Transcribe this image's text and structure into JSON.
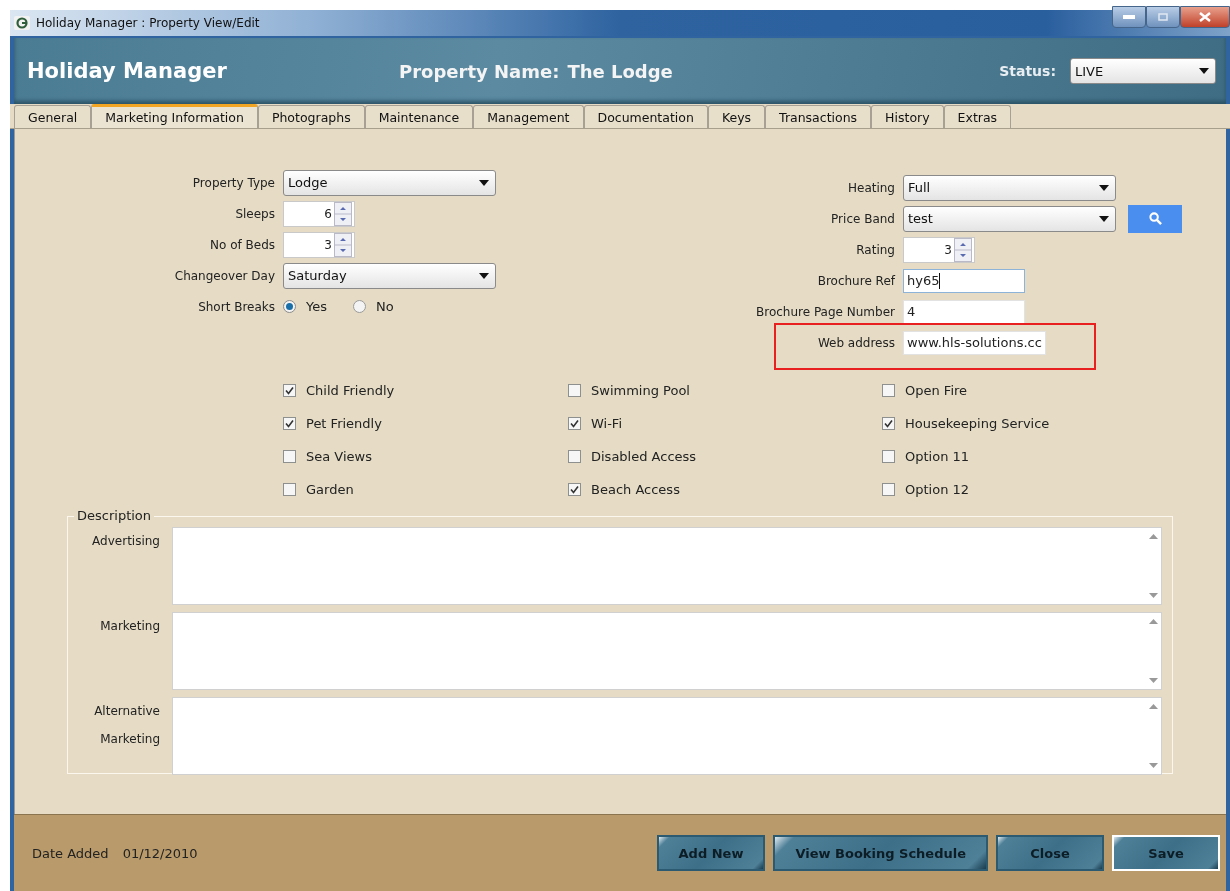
{
  "window": {
    "title": "Holiday Manager :  Property View/Edit"
  },
  "header": {
    "app_name": "Holiday Manager",
    "property_label": "Property Name:",
    "property_name": "The Lodge",
    "status_label": "Status:",
    "status_value": "LIVE"
  },
  "tabs": [
    {
      "label": "General",
      "selected": false
    },
    {
      "label": "Marketing Information",
      "selected": true
    },
    {
      "label": "Photographs",
      "selected": false
    },
    {
      "label": "Maintenance",
      "selected": false
    },
    {
      "label": "Management",
      "selected": false
    },
    {
      "label": "Documentation",
      "selected": false
    },
    {
      "label": "Keys",
      "selected": false
    },
    {
      "label": "Transactions",
      "selected": false
    },
    {
      "label": "History",
      "selected": false
    },
    {
      "label": "Extras",
      "selected": false
    }
  ],
  "left_fields": [
    {
      "kind": "dropdown",
      "label": "Property Type",
      "value": "Lodge"
    },
    {
      "kind": "spinner",
      "label": "Sleeps",
      "value": "6"
    },
    {
      "kind": "spinner",
      "label": "No of Beds",
      "value": "3"
    },
    {
      "kind": "dropdown",
      "label": "Changeover Day",
      "value": "Saturday"
    },
    {
      "kind": "radio",
      "label": "Short Breaks",
      "options": [
        {
          "label": "Yes",
          "selected": true
        },
        {
          "label": "No",
          "selected": false
        }
      ]
    }
  ],
  "right_fields": [
    {
      "kind": "dropdown",
      "label": "Heating",
      "value": "Full"
    },
    {
      "kind": "dropdown",
      "label": "Price Band",
      "value": "test",
      "search_button": true
    },
    {
      "kind": "spinner",
      "label": "Rating",
      "value": "3"
    },
    {
      "kind": "text",
      "label": "Brochure Ref",
      "value": "hy65",
      "focused": true
    },
    {
      "kind": "text",
      "label": "Brochure Page Number",
      "value": "4"
    },
    {
      "kind": "text",
      "label": "Web address",
      "value": "www.hls-solutions.cc",
      "highlighted": true
    }
  ],
  "features": [
    {
      "label": "Child Friendly",
      "checked": true
    },
    {
      "label": "Pet Friendly",
      "checked": true
    },
    {
      "label": "Sea Views",
      "checked": false
    },
    {
      "label": "Garden",
      "checked": false
    },
    {
      "label": "Swimming Pool",
      "checked": false
    },
    {
      "label": "Wi-Fi",
      "checked": true
    },
    {
      "label": "Disabled Access",
      "checked": false
    },
    {
      "label": "Beach Access",
      "checked": true
    },
    {
      "label": "Open Fire",
      "checked": false
    },
    {
      "label": "Housekeeping Service",
      "checked": true
    },
    {
      "label": "Option 11",
      "checked": false
    },
    {
      "label": "Option 12",
      "checked": false
    }
  ],
  "description": {
    "legend": "Description",
    "fields": [
      {
        "label": "Advertising"
      },
      {
        "label": "Marketing"
      },
      {
        "label": "Alternative Marketing"
      }
    ]
  },
  "footer": {
    "date_label": "Date Added",
    "date_value": "01/12/2010",
    "buttons": [
      {
        "label": "Add New",
        "default": false
      },
      {
        "label": "View Booking Schedule",
        "default": false
      },
      {
        "label": "Close",
        "default": false
      },
      {
        "label": "Save",
        "default": true
      }
    ]
  }
}
